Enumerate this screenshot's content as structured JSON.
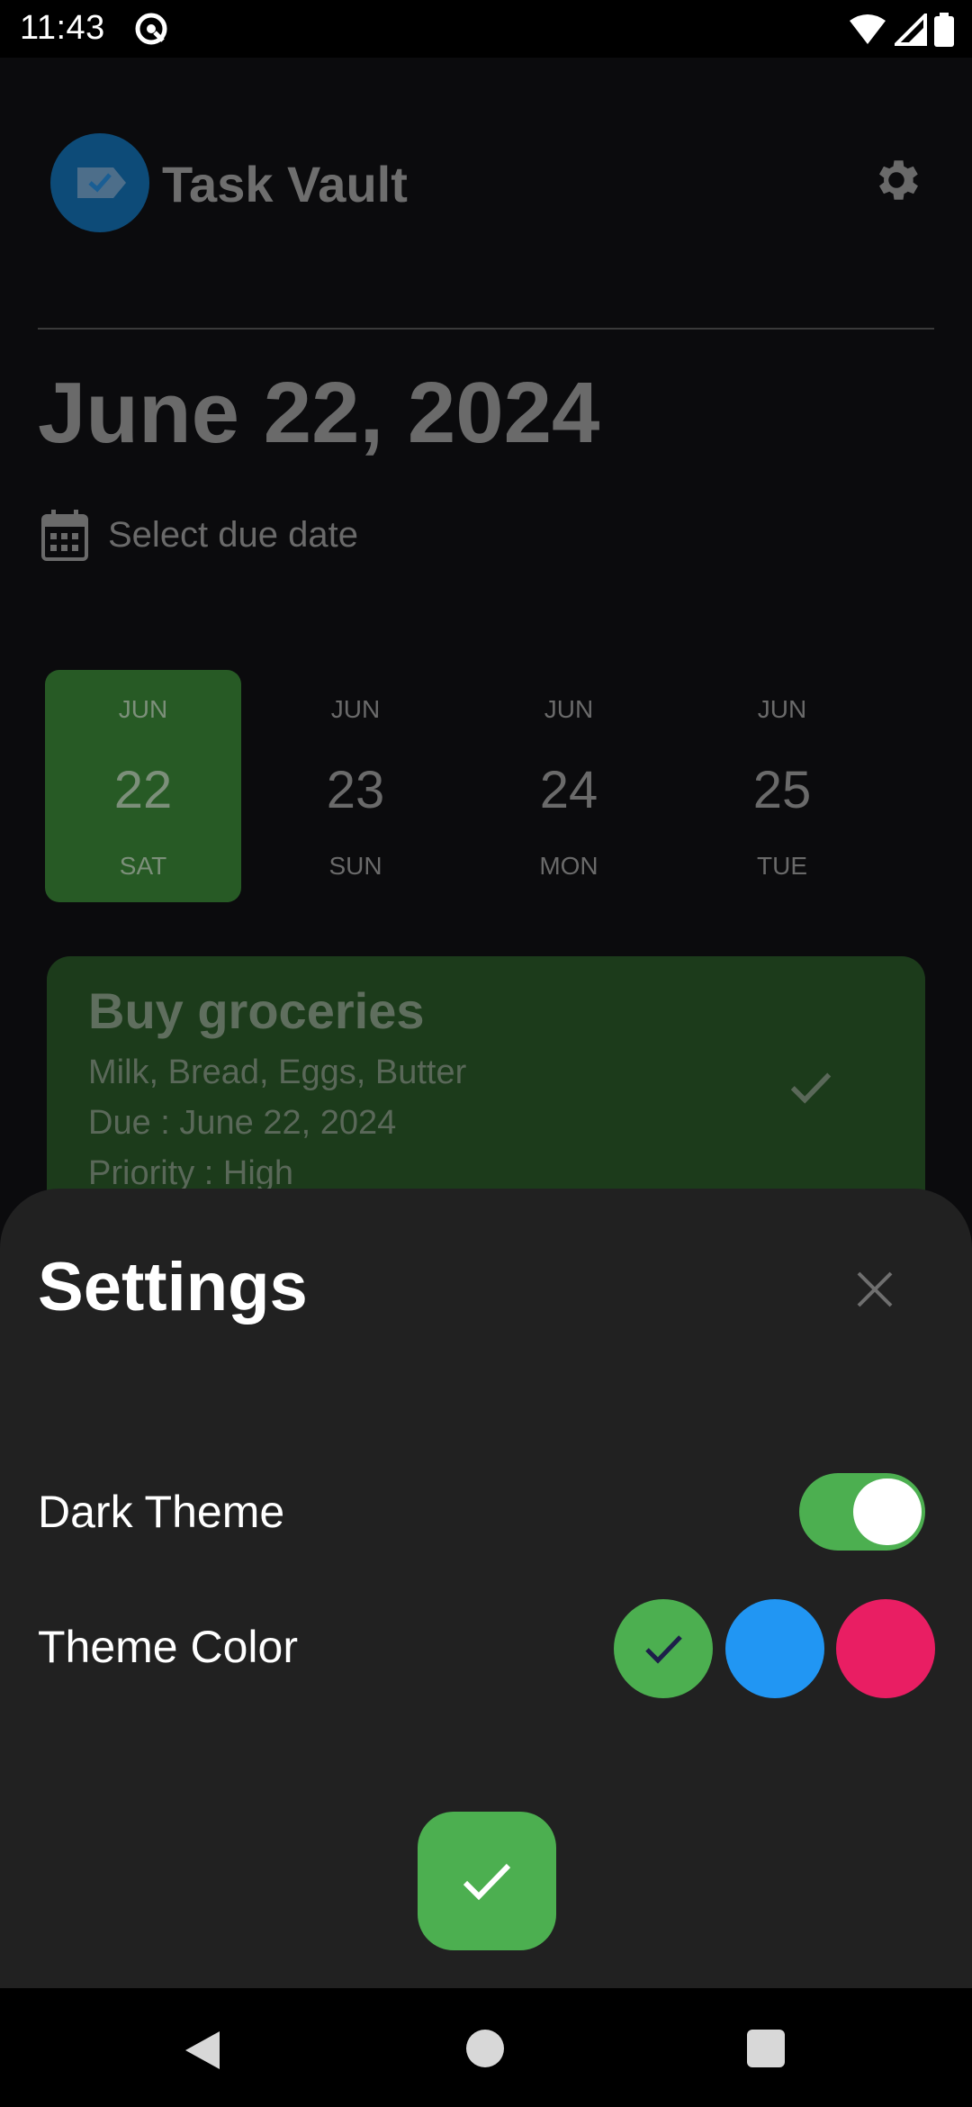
{
  "status_bar": {
    "time": "11:43",
    "icons": [
      "at-sign-icon",
      "wifi-icon",
      "signal-icon",
      "battery-icon"
    ]
  },
  "header": {
    "app_title": "Task Vault",
    "logo_icon": "tag-check-icon",
    "settings_icon": "gear-icon"
  },
  "main": {
    "date_title": "June 22, 2024",
    "due_date_label": "Select due date",
    "days": [
      {
        "month": "JUN",
        "day": "22",
        "weekday": "SAT",
        "selected": true
      },
      {
        "month": "JUN",
        "day": "23",
        "weekday": "SUN",
        "selected": false
      },
      {
        "month": "JUN",
        "day": "24",
        "weekday": "MON",
        "selected": false
      },
      {
        "month": "JUN",
        "day": "25",
        "weekday": "TUE",
        "selected": false
      }
    ],
    "tasks": [
      {
        "title": "Buy groceries",
        "description": "Milk, Bread, Eggs, Butter",
        "due": "Due : June 22, 2024",
        "priority": "Priority : High"
      }
    ]
  },
  "settings": {
    "title": "Settings",
    "dark_theme_label": "Dark Theme",
    "dark_theme_enabled": true,
    "theme_color_label": "Theme Color",
    "theme_colors": [
      "#4caf50",
      "#2196f3",
      "#e91e63"
    ],
    "selected_color": "#4caf50"
  },
  "colors": {
    "sheet_bg": "#212121",
    "accent": "#4caf50",
    "card_dim": "#1c3b1b"
  }
}
